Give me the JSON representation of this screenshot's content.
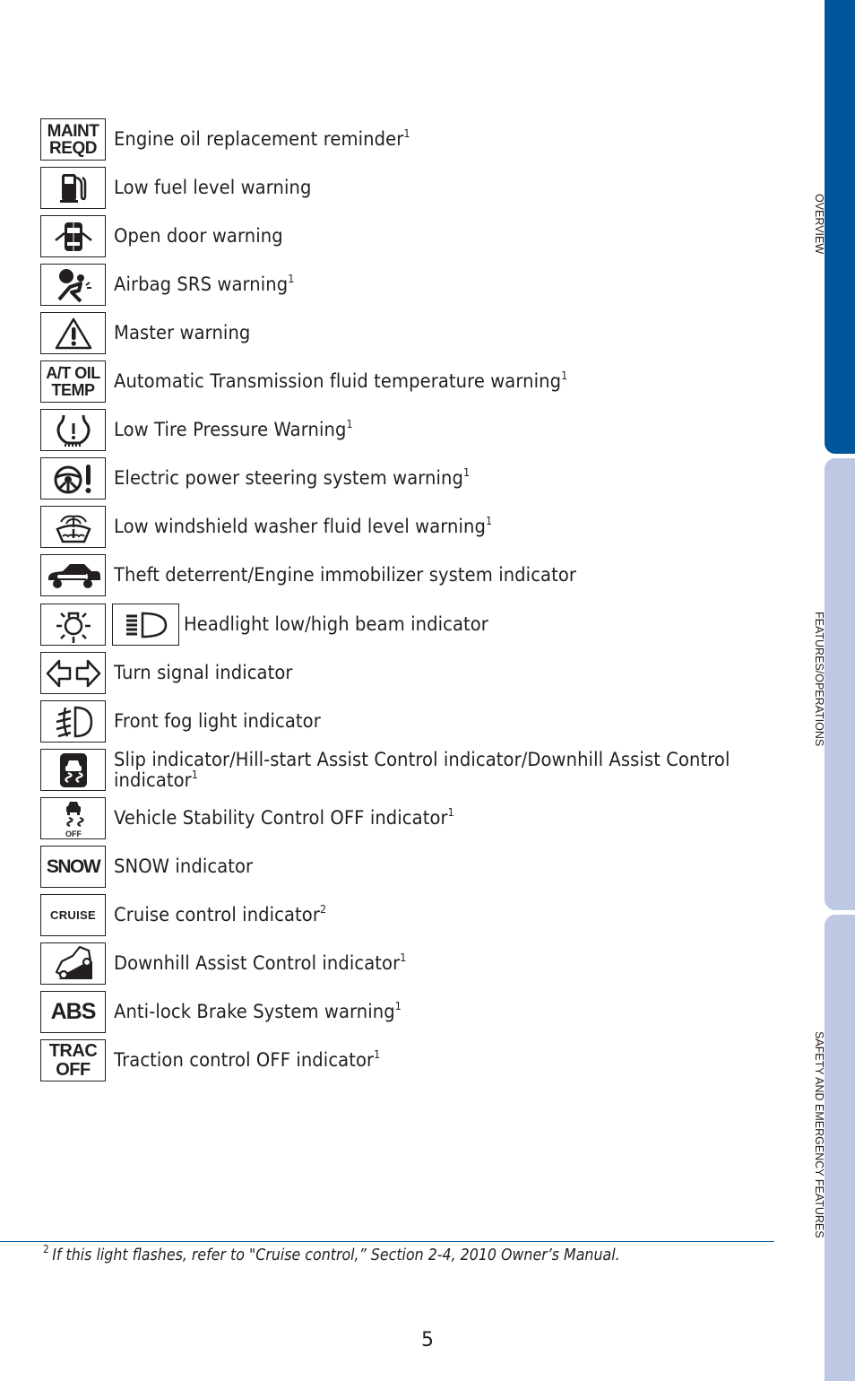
{
  "side_tabs": [
    {
      "label": "OVERVIEW",
      "active": true,
      "color": "#00569b"
    },
    {
      "label": "FEATURES/OPERATIONS",
      "active": false,
      "color": "#bdc8e2"
    },
    {
      "label": "SAFETY AND EMERGENCY FEATURES",
      "active": false,
      "color": "#bdc8e2"
    }
  ],
  "indicators": [
    {
      "icon": "maint-reqd-icon",
      "icon_text": [
        "MAINT",
        "REQD"
      ],
      "label": "Engine oil replacement reminder",
      "footnote": "1"
    },
    {
      "icon": "fuel-pump-icon",
      "label": "Low fuel level warning",
      "footnote": ""
    },
    {
      "icon": "open-door-icon",
      "label": "Open door warning",
      "footnote": ""
    },
    {
      "icon": "airbag-icon",
      "label": "Airbag SRS warning",
      "footnote": "1"
    },
    {
      "icon": "master-warning-icon",
      "label": "Master warning",
      "footnote": ""
    },
    {
      "icon": "at-oil-temp-icon",
      "icon_text": [
        "A/T OIL",
        "TEMP"
      ],
      "label": "Automatic Transmission fluid temperature warning",
      "footnote": "1"
    },
    {
      "icon": "tire-pressure-icon",
      "label": "Low Tire Pressure Warning",
      "footnote": "1"
    },
    {
      "icon": "power-steering-icon",
      "label": "Electric power steering system warning",
      "footnote": "1"
    },
    {
      "icon": "washer-fluid-icon",
      "label": "Low windshield washer fluid level warning",
      "footnote": "1"
    },
    {
      "icon": "car-key-icon",
      "label": "Theft deterrent/Engine immobilizer system indicator",
      "footnote": ""
    },
    {
      "icon": "headlight-icon",
      "label": "Headlight low/high beam indicator",
      "footnote": ""
    },
    {
      "icon": "turn-signal-icon",
      "label": "Turn signal indicator",
      "footnote": ""
    },
    {
      "icon": "fog-light-icon",
      "label": "Front fog light indicator",
      "footnote": ""
    },
    {
      "icon": "slip-indicator-icon",
      "label": "Slip indicator/Hill-start Assist Control indicator/Downhill Assist Control indicator",
      "footnote": "1"
    },
    {
      "icon": "vsc-off-icon",
      "icon_text": [
        "OFF"
      ],
      "label": "Vehicle Stability Control OFF indicator",
      "footnote": "1"
    },
    {
      "icon": "snow-icon",
      "icon_text": [
        "SNOW"
      ],
      "label": "SNOW indicator",
      "footnote": ""
    },
    {
      "icon": "cruise-icon",
      "icon_text": [
        "CRUISE"
      ],
      "label": "Cruise control indicator",
      "footnote": "2"
    },
    {
      "icon": "downhill-assist-icon",
      "label": "Downhill Assist Control indicator",
      "footnote": "1"
    },
    {
      "icon": "abs-icon",
      "icon_text": [
        "ABS"
      ],
      "label": "Anti-lock Brake System warning",
      "footnote": "1"
    },
    {
      "icon": "trac-off-icon",
      "icon_text": [
        "TRAC",
        "OFF"
      ],
      "label": "Traction control OFF indicator",
      "footnote": "1"
    }
  ],
  "footnote": {
    "marker": "2",
    "text": "If this light flashes, refer to \"Cruise control,” Section 2-4, 2010 Owner’s Manual."
  },
  "page_number": "5"
}
